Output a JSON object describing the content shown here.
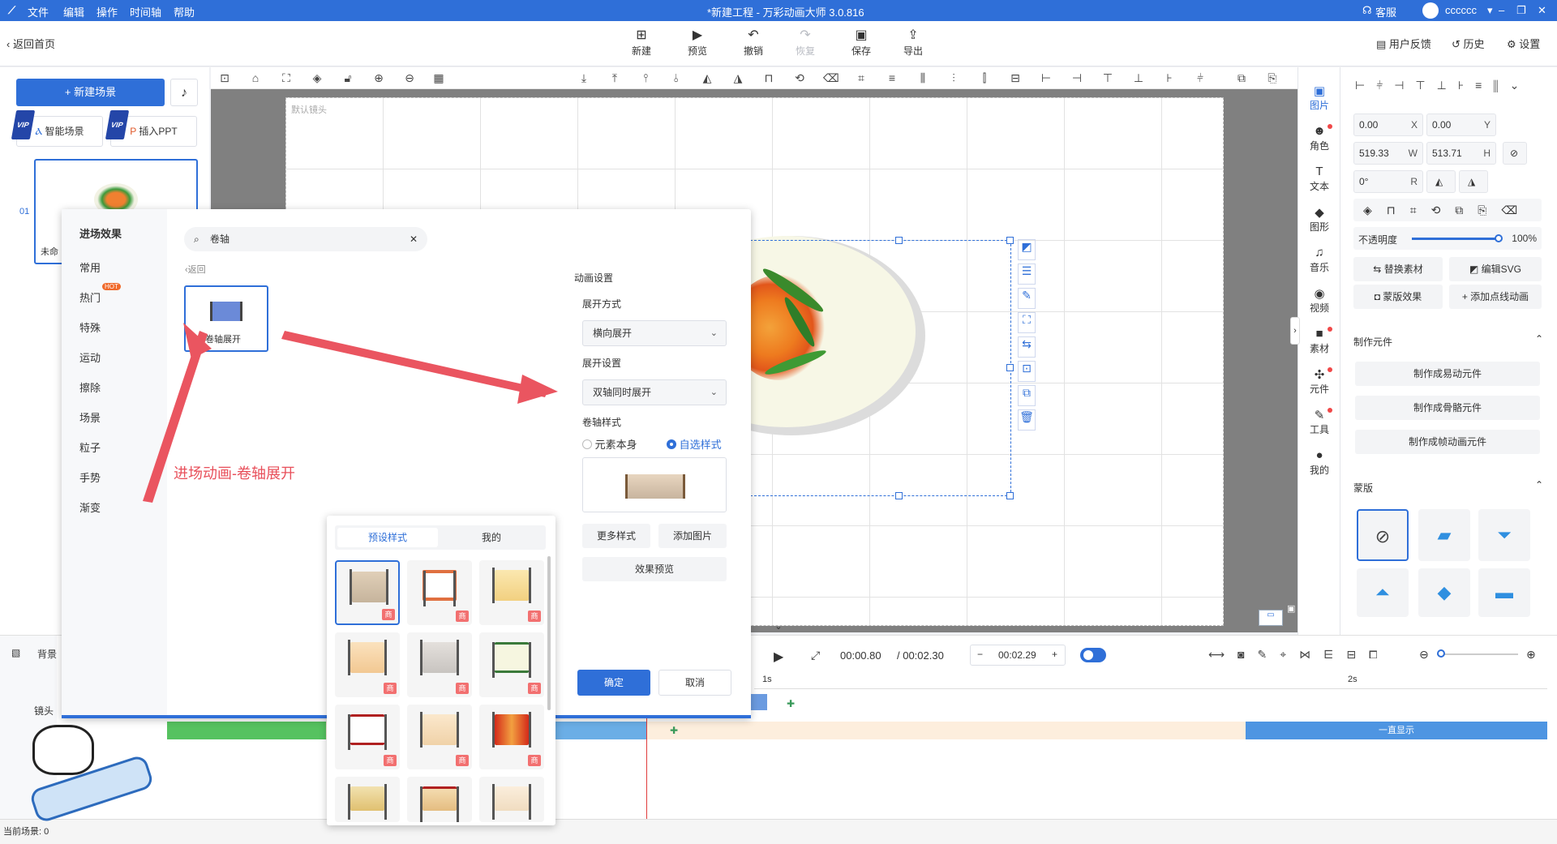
{
  "menu": {
    "items": [
      "文件",
      "编辑",
      "操作",
      "时间轴",
      "帮助"
    ],
    "title": "*新建工程 - 万彩动画大师 3.0.816",
    "support": "客服",
    "user": "cccccc"
  },
  "toolbar": {
    "back": "返回首页",
    "new": "新建",
    "preview": "预览",
    "undo": "撤销",
    "redo": "恢复",
    "save": "保存",
    "export": "导出",
    "feedback": "用户反馈",
    "history": "历史",
    "settings": "设置"
  },
  "left": {
    "new_scene": "+ 新建场景",
    "vip": "VIP",
    "smart_scene": "智能场景",
    "insert_ppt": "插入PPT",
    "scene_no": "01",
    "scene_label": "未命"
  },
  "canvas": {
    "camera_label": "默认镜头"
  },
  "right_strip": [
    {
      "label": "图片",
      "icon": "image-icon"
    },
    {
      "label": "角色",
      "icon": "person-icon"
    },
    {
      "label": "文本",
      "icon": "text-icon"
    },
    {
      "label": "图形",
      "icon": "shape-icon"
    },
    {
      "label": "音乐",
      "icon": "music-icon"
    },
    {
      "label": "视频",
      "icon": "video-icon"
    },
    {
      "label": "素材",
      "icon": "folder-icon"
    },
    {
      "label": "元件",
      "icon": "component-icon"
    },
    {
      "label": "工具",
      "icon": "wrench-icon"
    },
    {
      "label": "我的",
      "icon": "user-icon"
    }
  ],
  "props": {
    "x": "0.00",
    "x_label": "X",
    "y": "0.00",
    "y_label": "Y",
    "w": "519.33",
    "w_label": "W",
    "h": "513.71",
    "h_label": "H",
    "r": "0°",
    "r_label": "R",
    "opacity_label": "不透明度",
    "opacity": "100%",
    "opacity_value": 1.0,
    "replace": "替换素材",
    "edit_svg": "编辑SVG",
    "mask_effect": "蒙版效果",
    "add_point_anim": "添加点线动画",
    "make_component": "制作元件",
    "make_easy": "制作成易动元件",
    "make_bone": "制作成骨骼元件",
    "make_frame": "制作成帧动画元件",
    "mask_section": "蒙版"
  },
  "popup": {
    "title": "进场效果",
    "categories": [
      "常用",
      "热门",
      "特殊",
      "运动",
      "擦除",
      "场景",
      "粒子",
      "手势",
      "渐变"
    ],
    "hot": "HOT",
    "search": "卷轴",
    "back": "返回",
    "effect_name": "卷轴展开",
    "annotation": "进场动画-卷轴展开",
    "anim_settings": "动画设置",
    "expand_mode_label": "展开方式",
    "expand_mode": "横向展开",
    "expand_setting_label": "展开设置",
    "expand_setting": "双轴同时展开",
    "scroll_style_label": "卷轴样式",
    "opt_element": "元素本身",
    "opt_custom": "自选样式",
    "more_styles": "更多样式",
    "add_image": "添加图片",
    "preview_effect": "效果预览",
    "ok": "确定",
    "cancel": "取消"
  },
  "style_panel": {
    "tab_preset": "预设样式",
    "tab_mine": "我的",
    "badge": "商"
  },
  "timeline": {
    "current": "00:00.80",
    "total": "/ 00:02.30",
    "step": "00:02.29",
    "tick1": "1s",
    "tick2": "2s",
    "bg_label": "背景",
    "camera_label": "镜头",
    "always_show": "一直显示",
    "current_scene": "当前场景: 0"
  }
}
